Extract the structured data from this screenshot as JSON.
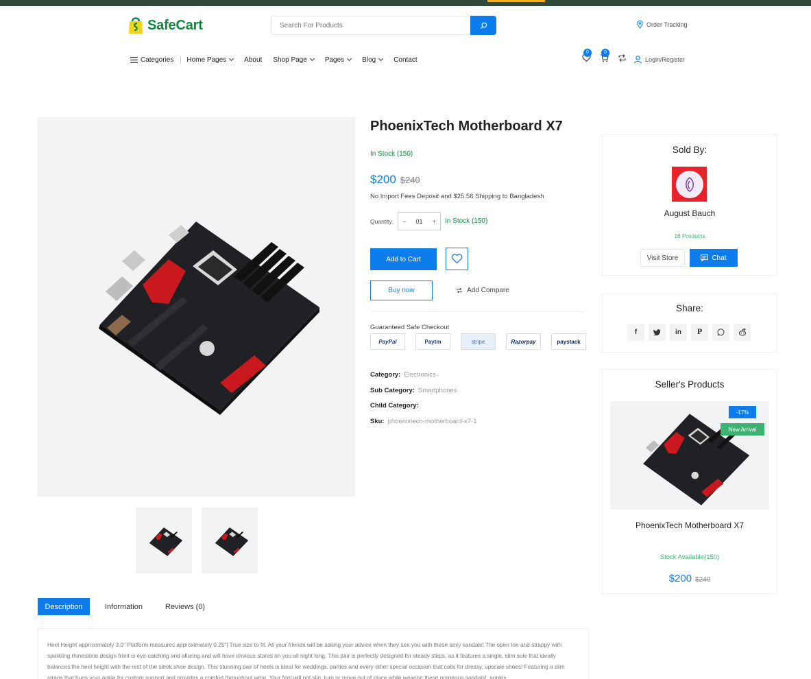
{
  "header": {
    "brand": "SafeCart",
    "search_placeholder": "Search For Products",
    "order_tracking": "Order Tracking",
    "categories": "Categories",
    "nav": [
      "Home Pages",
      "About",
      "Shop Page",
      "Pages",
      "Blog",
      "Contact"
    ],
    "wishlist_count": "0",
    "cart_count": "0",
    "login": "Login/Register",
    "accent_color": "#0d7dee",
    "brand_color": "#0e8a3c"
  },
  "product": {
    "title": "PhoenixTech Motherboard X7",
    "stock": "In Stock (150)",
    "price": "$200",
    "old_price": "$240",
    "shipping": "No Import Fees Deposit and $25.56 Shipping to Bangladesh",
    "quantity_label": "Quantity:",
    "quantity_value": "01",
    "quantity_stock": "In Stock (150)",
    "add_to_cart": "Add to Cart",
    "buy_now": "Buy now",
    "add_compare": "Add Compare",
    "guaranteed": "Guaranteed Safe Checkout",
    "payments": [
      "PayPal",
      "Paytm",
      "stripe",
      "Razorpay",
      "paystack"
    ],
    "category_label": "Category:",
    "category": "Electronics",
    "subcategory_label": "Sub Category:",
    "subcategory": "Smartphones",
    "childcategory_label": "Child Category:",
    "sku_label": "Sku:",
    "sku": "phoenixtech-motherboard-x7-1"
  },
  "seller": {
    "sold_by": "Sold By:",
    "name": "August Bauch",
    "products": "16 Products",
    "visit_store": "Visit Store",
    "chat": "Chat"
  },
  "share": {
    "title": "Share:",
    "icons": [
      "facebook-icon",
      "twitter-icon",
      "linkedin-icon",
      "pinterest-icon",
      "whatsapp-icon",
      "reddit-icon"
    ]
  },
  "seller_products": {
    "title": "Seller's Products",
    "discount": "-17%",
    "badge": "New Arrival",
    "name": "PhoenixTech Motherboard X7",
    "stock": "Stock Available(150)",
    "price": "$200",
    "old_price": "$240"
  },
  "tabs": {
    "description": "Description",
    "information": "Information",
    "reviews": "Reviews (0)"
  },
  "description": "Heel Height approximately 3.0\" Platform measures approximately 0.25\"| True size to fit. All your friends will be asking your advice when they see you with these sexy sandals! The open toe and strappy with sparkling rhinestone design front is eye-catching and alluring and will have envious stares on you all night long. This pair is perfectly designed for steady steps, as it features a single, slim sole that ideally balances the heel height with the rest of the sleek shoe design. This stunning pair of heels is ideal for weddings, parties and every other special occasion that calls for dressy, upscale shoes! Featuring a slim straps that hugs your ankle for custom support and provides a comfort throughout wear. Your feet will not slip, turn or move out of place while wearing these gorgeous sandals!, apples"
}
